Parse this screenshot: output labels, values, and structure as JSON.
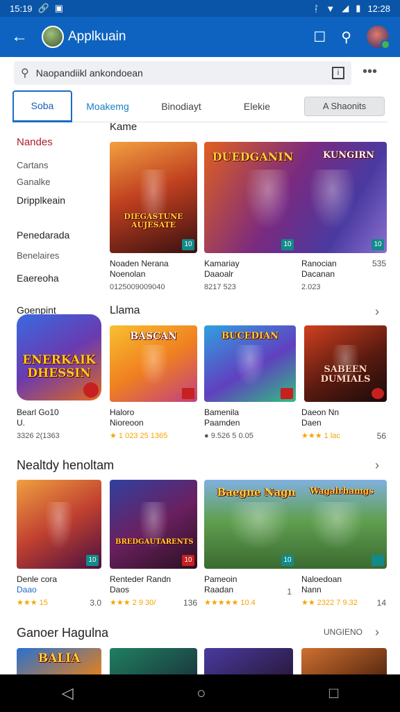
{
  "status": {
    "time": "15:19",
    "right_time": "12:28"
  },
  "appbar": {
    "title": "Applkuain"
  },
  "search": {
    "placeholder": "Naopandiikl ankondoean"
  },
  "tabs": [
    {
      "label": "Soba"
    },
    {
      "label": "Moakemg"
    },
    {
      "label": "Binodiayt"
    },
    {
      "label": "Elekie"
    },
    {
      "label": "A Shaonits"
    }
  ],
  "sidebar": {
    "items": [
      "Nandes",
      "Cartans",
      "Ganalke",
      "Dripplkeain",
      "Penedarada",
      "Benelaires",
      "Eaereoha",
      "Goenpint"
    ]
  },
  "sections": {
    "s1_title": "Kame",
    "s2_title": "Llama",
    "s3_title": "Nealtdy henoltam",
    "s4_title": "Ganoer Hagulna",
    "s4_link": "UNGIENO"
  },
  "row1": [
    {
      "art": "DIEGASTUNE AUJESATE",
      "badge": "10",
      "name": "Noaden Nerana",
      "sub": "Noenolan",
      "info": "0125009009040",
      "right": ""
    },
    {
      "art": "DUEDGANIN",
      "art2": "KUNGIRN",
      "badge": "10",
      "name": "Kamariay",
      "sub": "Daaoalr",
      "info": "8217 523",
      "right": ""
    },
    {
      "art": "",
      "badge": "10",
      "name": "Ranocian",
      "sub": "Dacanan",
      "info": "2.023",
      "right": "535"
    }
  ],
  "row2": [
    {
      "art": "ENERKAIK DHESSIN",
      "name": "Bearl Go10",
      "sub": "U.",
      "info": "3326 2(1363",
      "right": ""
    },
    {
      "art": "BASCAN",
      "name": "Haloro",
      "sub": "Nioreoon",
      "info": "★ 1 023 25 1365",
      "right": ""
    },
    {
      "art": "BUCEDIAN",
      "name": "Bamenila",
      "sub": "Paamden",
      "info": "● 9.526 5 0.05",
      "right": ""
    },
    {
      "art": "SABEEN DUMIALS",
      "name": "Daeon Nn",
      "sub": "Daen",
      "info": "★★★ 1 lac",
      "right": "56"
    }
  ],
  "row3": [
    {
      "art": "",
      "badge": "10",
      "name": "Denle cora",
      "sub": "Daao",
      "info": "★★★ 15",
      "right": "3.0"
    },
    {
      "art": "BREDGAUTARENTS",
      "badge": "10",
      "name": "Renteder Randn",
      "sub": "Daos",
      "info": "★★★ 2 9 30/",
      "right": "136"
    },
    {
      "art": "Baegne Nagn",
      "art2": "Wagalrhamgs",
      "badge": "10",
      "name": "Pameoin",
      "sub": "Raadan",
      "info": "★★★★★ 10.4",
      "right": "1"
    },
    {
      "art": "",
      "badge": "",
      "name": "Naloedoan",
      "sub": "Nann",
      "info": "★★ 2322 7 9.32",
      "right": "14"
    }
  ],
  "row4": [
    {
      "art": "BALIA"
    },
    {
      "art": ""
    },
    {
      "art": ""
    },
    {
      "art": ""
    }
  ],
  "colors": {
    "appbar": "#0e63c0",
    "statusbar": "#0a55a8",
    "accent_text": "#b01a2a",
    "badge": "#128a8a"
  }
}
